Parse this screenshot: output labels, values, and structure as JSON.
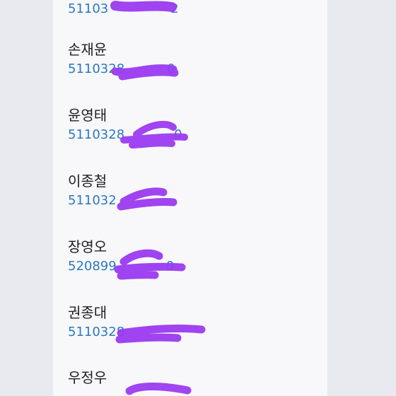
{
  "list": {
    "items": [
      {
        "name": "",
        "account_visible": "51103",
        "account_tail": "2"
      },
      {
        "name": "손재윤",
        "account_visible": "5110328",
        "account_tail": "0"
      },
      {
        "name": "윤영태",
        "account_visible": "5110328",
        "account_tail": "0"
      },
      {
        "name": "이종철",
        "account_visible": "511032",
        "account_tail": ""
      },
      {
        "name": "장영오",
        "account_visible": "520899",
        "account_tail": "0"
      },
      {
        "name": "권종대",
        "account_visible": "5110328",
        "account_tail": ""
      },
      {
        "name": "우정우",
        "account_visible": "",
        "account_tail": ""
      }
    ]
  },
  "colors": {
    "background": "#e9eaef",
    "panel": "#f8f8fb",
    "name_text": "#1f1f1f",
    "account_text": "#2b79bd",
    "redaction": "#9b3bf0"
  }
}
